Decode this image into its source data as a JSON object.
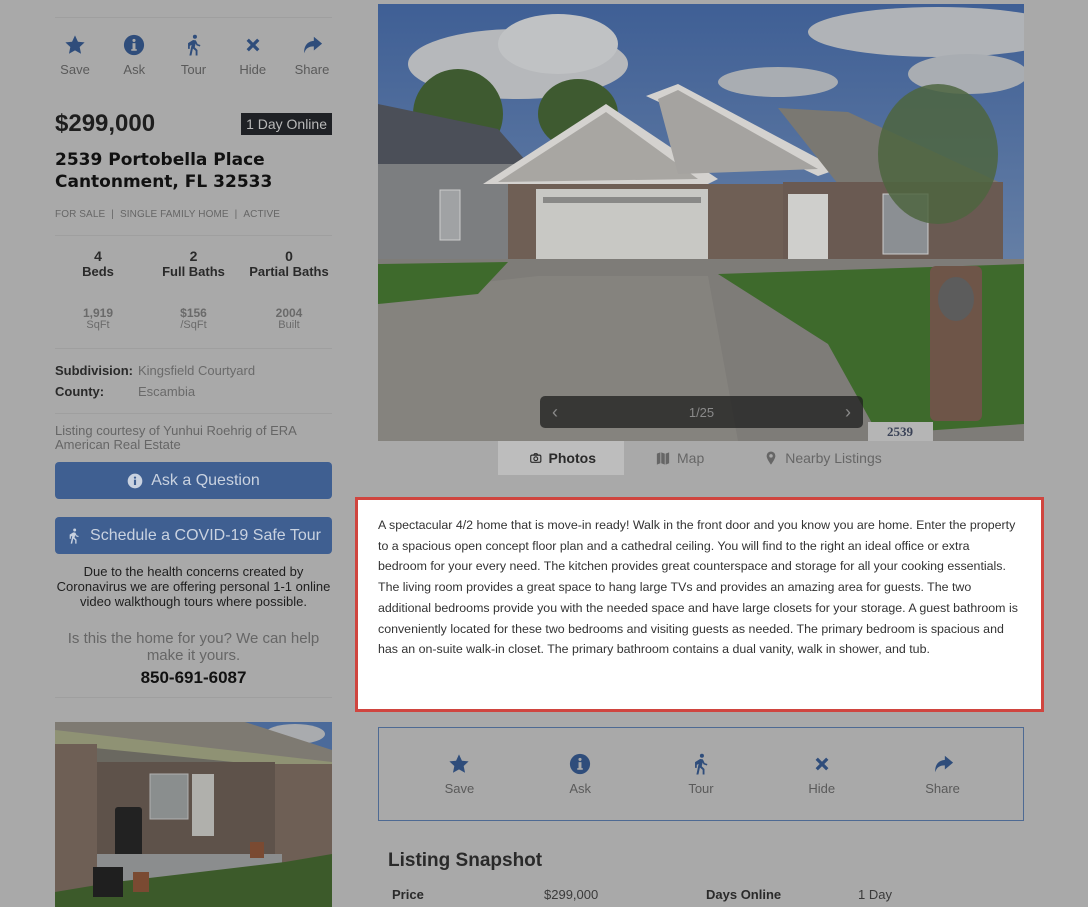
{
  "actions": [
    {
      "icon": "star-icon",
      "label": "Save"
    },
    {
      "icon": "info-icon",
      "label": "Ask"
    },
    {
      "icon": "walking-icon",
      "label": "Tour"
    },
    {
      "icon": "close-icon",
      "label": "Hide"
    },
    {
      "icon": "share-icon",
      "label": "Share"
    }
  ],
  "listing": {
    "price": "$299,000",
    "days_online_badge": "1 Day Online",
    "address_line1": "2539 Portobella Place",
    "address_line2": "Cantonment, FL 32533",
    "tags": [
      "FOR SALE",
      "SINGLE FAMILY HOME",
      "ACTIVE"
    ],
    "tag_separator": "|",
    "stats": [
      {
        "value": "4",
        "label": "Beds"
      },
      {
        "value": "2",
        "label": "Full Baths"
      },
      {
        "value": "0",
        "label": "Partial Baths"
      }
    ],
    "stats_secondary": [
      {
        "value": "1,919",
        "label": "SqFt"
      },
      {
        "value": "$156",
        "label": "/SqFt"
      },
      {
        "value": "2004",
        "label": "Built"
      }
    ],
    "subdivision_label": "Subdivision:",
    "subdivision": "Kingsfield Courtyard",
    "county_label": "County:",
    "county": "Escambia",
    "courtesy": "Listing courtesy of Yunhui Roehrig of ERA American Real Estate"
  },
  "buttons": {
    "ask": "Ask a Question",
    "tour": "Schedule a COVID-19 Safe Tour"
  },
  "covid_note": "Due to the health concerns created by Coronavirus we are offering personal 1-1 online video walkthough tours where possible.",
  "help_text": "Is this the home for you? We can help make it yours.",
  "phone": "850-691-6087",
  "gallery": {
    "counter": "1/25",
    "prev_icon": "chevron-left-icon",
    "next_icon": "chevron-right-icon",
    "curb_number": "2539"
  },
  "tabs": [
    {
      "icon": "camera-icon",
      "label": "Photos",
      "active": true
    },
    {
      "icon": "map-icon",
      "label": "Map",
      "active": false
    },
    {
      "icon": "map-pin-icon",
      "label": "Nearby Listings",
      "active": false
    }
  ],
  "description": "A spectacular 4/2 home that is move-in ready! Walk in the front door and you know you are home. Enter the property to a spacious open concept floor plan and a cathedral ceiling. You will find to the right an ideal office or extra bedroom for your every need. The kitchen provides great counterspace and storage for all your cooking essentials. The living room provides a great space to hang large TVs and provides an amazing area for guests. The two additional bedrooms provide you with the needed space and have large closets for your storage. A guest bathroom is conveniently located for these two bedrooms and visiting guests as needed. The primary bedroom is spacious and has an on-suite walk-in closet. The primary bathroom contains a dual vanity, walk in shower, and tub.",
  "snapshot": {
    "title": "Listing Snapshot",
    "rows": [
      {
        "key": "Price",
        "value": "$299,000"
      },
      {
        "key": "Days Online",
        "value": "1 Day"
      }
    ]
  },
  "colors": {
    "accent": "#3f5f91",
    "icon": "#2f4d7b",
    "highlight_border": "#d0453f",
    "overlay": "#a9a9a9"
  }
}
